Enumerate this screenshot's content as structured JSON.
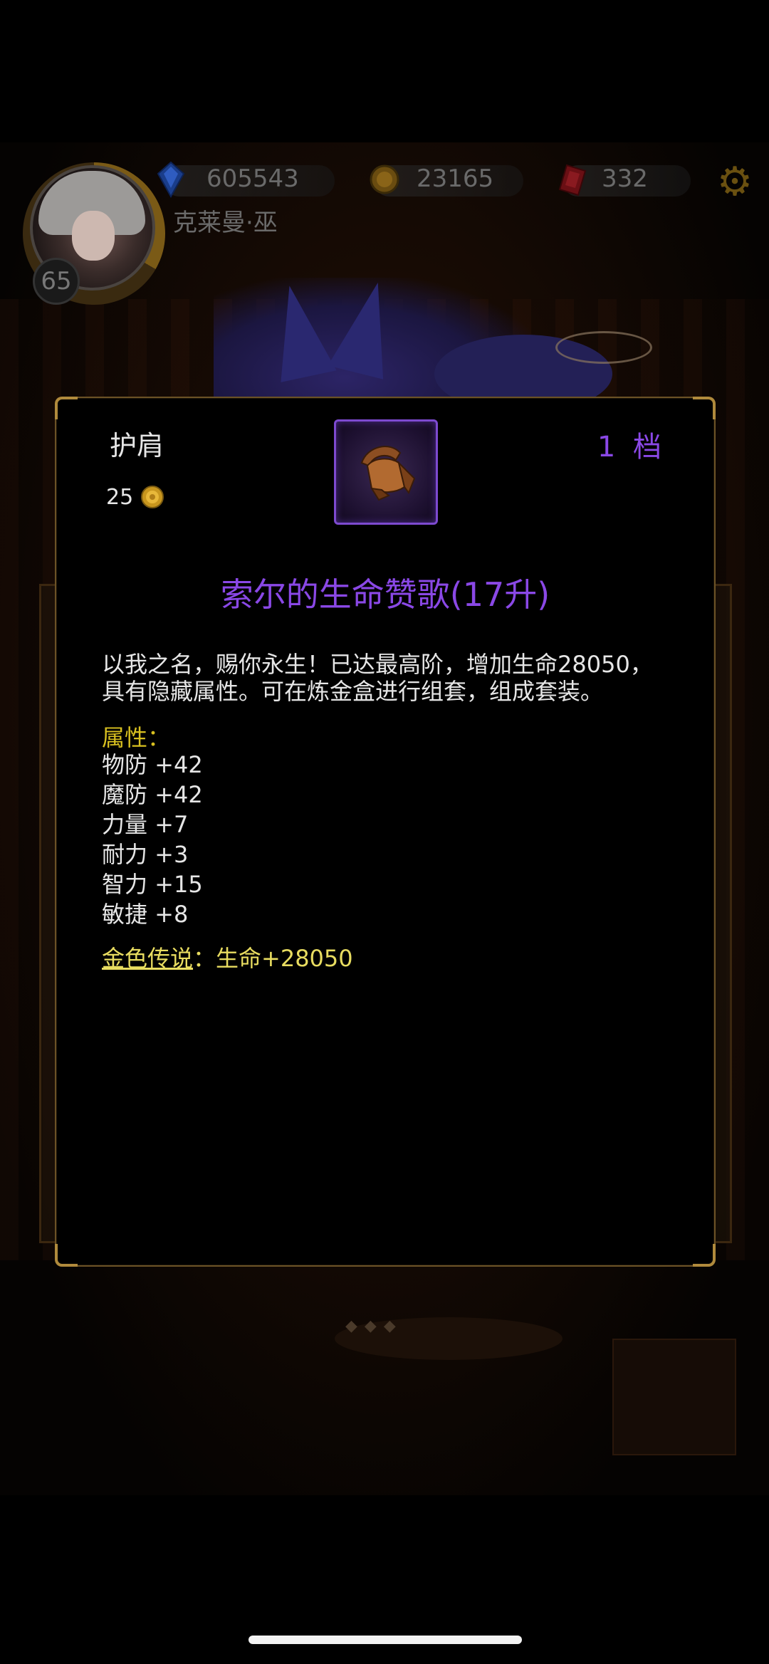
{
  "hud": {
    "level": "65",
    "player_name": "克莱曼·巫",
    "resources": [
      {
        "icon": "blue-gem-icon",
        "value": "605543"
      },
      {
        "icon": "gold-coin-icon",
        "value": "23165"
      },
      {
        "icon": "red-crystal-icon",
        "value": "332"
      }
    ],
    "settings_icon": "gear-icon"
  },
  "item": {
    "slot": "护肩",
    "price": "25",
    "price_icon": "gold-coin-icon",
    "image_icon": "shoulder-armor-icon",
    "tier": "1 档",
    "name": "索尔的生命赞歌(17升)",
    "description": "以我之名，赐你永生！已达最高阶，增加生命28050，具有隐藏属性。可在炼金盒进行组套，组成套装。",
    "attributes_label": "属性：",
    "attributes": [
      "物防 +42",
      "魔防 +42",
      "力量 +7",
      "耐力 +3",
      "智力 +15",
      "敏捷 +8"
    ],
    "legend_link": "金色传说",
    "legend_value": "：生命+28050"
  },
  "colors": {
    "accent_purple": "#8a48e6",
    "gold_text": "#d8c020",
    "frame_gold": "#b08a3c"
  }
}
